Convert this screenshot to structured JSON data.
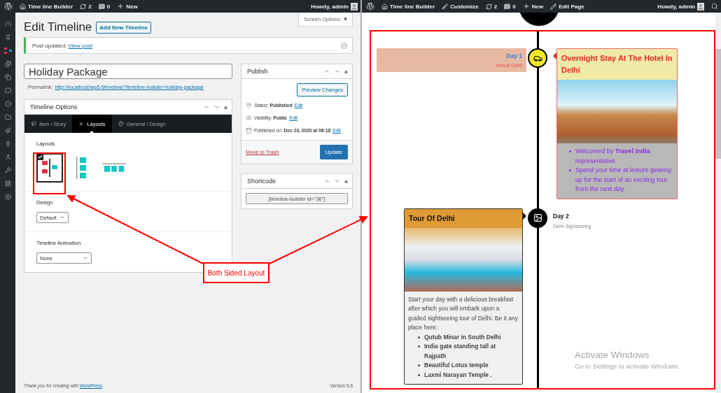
{
  "admin_panel": {
    "admin_bar": {
      "site": "Time line Builder",
      "updates": "2",
      "comments": "0",
      "new_label": "New",
      "greeting": "Howdy, admin"
    },
    "screen_options": "Screen Options",
    "heading": "Edit Timeline",
    "add_new": "Add New Timeline",
    "notice": {
      "text": "Post updated.",
      "link": "View post"
    },
    "title_value": "Holiday Package",
    "permalink": {
      "label": "Permalink:",
      "url": "http://localhost/wp5.6timeline/?timeline-builder=holiday-package"
    },
    "options_box": {
      "title": "Timeline Options",
      "tabs": [
        {
          "label": "Item / Story",
          "selected": false
        },
        {
          "label": "Layouts",
          "selected": true
        },
        {
          "label": "General / Design",
          "selected": false
        }
      ],
      "layouts_label": "Layouts",
      "layouts": [
        {
          "kind": "alternating",
          "selected": true
        },
        {
          "kind": "vertical",
          "selected": false
        },
        {
          "kind": "horizontal",
          "selected": false
        }
      ],
      "design_label": "Design",
      "design_value": "Default",
      "animation_label": "Timeline Animation",
      "animation_value": "None"
    },
    "publish": {
      "title": "Publish",
      "preview": "Preview Changes",
      "rows": [
        {
          "label": "Status:",
          "value": "Published",
          "link": "Edit"
        },
        {
          "label": "Visibility:",
          "value": "Public",
          "link": "Edit"
        },
        {
          "label": "Published on:",
          "value": "Dec 23, 2020 at 06:18",
          "link": "Edit"
        }
      ],
      "trash": "Move to Trash",
      "update": "Update"
    },
    "shortcode": {
      "title": "Shortcode",
      "value": "[timeline-builder id=\"36\"]"
    },
    "footer": {
      "text_before": "Thank you for creating with",
      "link": "WordPress",
      "text_after": ".",
      "version": "Version 5.6"
    }
  },
  "preview": {
    "admin_bar": {
      "site": "Time line Builder",
      "customize": "Customize",
      "updates": "2",
      "comments": "0",
      "new_label": "New",
      "edit_page": "Edit Page",
      "greeting": "Howdy, admin"
    },
    "timeline": [
      {
        "kind": "card-right",
        "day": "Day 1",
        "subtitle": "Arrival Delhi",
        "card": {
          "title": "Overnight Stay At The Hotel In Delhi",
          "items": [
            "Welcomed by **Travel India** representative.",
            "Spend your time at leisure gearing up for the start of an exciting tour from the next day."
          ]
        }
      },
      {
        "kind": "card-left",
        "day": "Day 2",
        "subtitle": "Delhi Sightseeing",
        "card": {
          "title": "Tour Of Delhi",
          "intro": "Start your day with a delicious breakfast after which you will embark upon a guided sightseeing tour of Delhi. Be it any place here:",
          "items": [
            "Qutub Minar in South Delhi",
            "India gate standing tall at Rajpath",
            "Beautiful Lotus temple",
            "Laxmi Narayan Temple ."
          ]
        }
      }
    ],
    "os_notice": {
      "title": "Activate Windows",
      "subtitle": "Go to Settings to activate Windows."
    }
  },
  "callout": {
    "label": "Both Sided Layout"
  }
}
